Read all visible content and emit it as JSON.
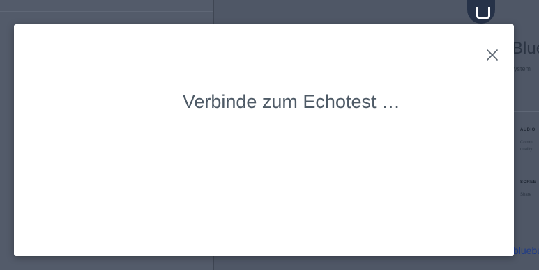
{
  "background": {
    "title": "Blue",
    "subtitle": "ystem",
    "features": [
      {
        "title": "AUDIO",
        "desc_lines": [
          "Comm",
          "quality"
        ]
      },
      {
        "title": "SCREE",
        "desc_lines": [
          "Share"
        ]
      }
    ],
    "link": "bluebu"
  },
  "modal": {
    "message": "Verbinde zum Echotest …",
    "close_icon": "close-icon"
  },
  "colors": {
    "overlay": "#4d5564",
    "modal_bg": "#ffffff",
    "message_text": "#4e5a66",
    "link": "#1f3b88"
  }
}
